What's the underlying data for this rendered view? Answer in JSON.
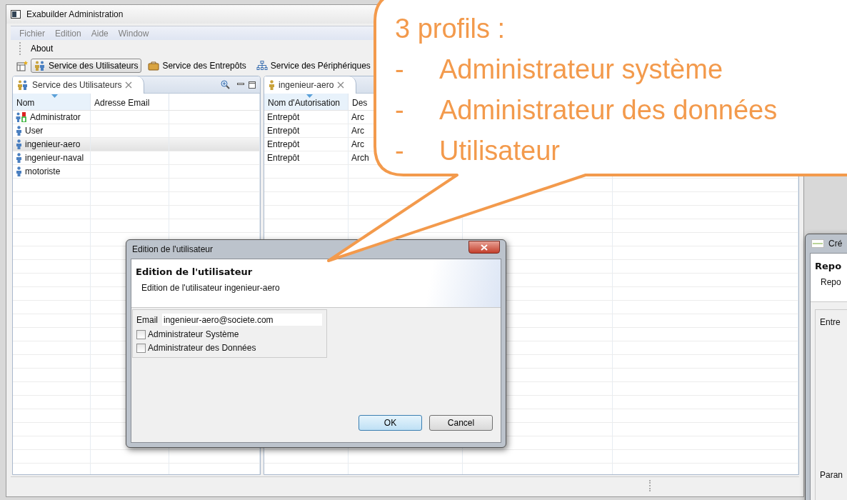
{
  "window": {
    "title": "Exabuilder Administration"
  },
  "menu": [
    "Fichier",
    "Edition",
    "Aide",
    "Window"
  ],
  "toolbar": [
    "About"
  ],
  "perspectives": [
    {
      "label": "Service des Utilisateurs",
      "selected": true,
      "kind": "users"
    },
    {
      "label": "Service des Entrepôts",
      "selected": false,
      "kind": "warehouse"
    },
    {
      "label": "Service des Périphériques",
      "selected": false,
      "kind": "devices"
    }
  ],
  "users_view": {
    "tab": "Service des Utilisateurs",
    "columns": [
      "Nom",
      "Adresse Email"
    ],
    "rows": [
      {
        "name": "Administrator",
        "kind": "admin",
        "selected": false
      },
      {
        "name": "User",
        "kind": "user",
        "selected": false
      },
      {
        "name": "ingenieur-aero",
        "kind": "user",
        "selected": true
      },
      {
        "name": "ingenieur-naval",
        "kind": "user",
        "selected": false
      },
      {
        "name": "motoriste",
        "kind": "user",
        "selected": false
      }
    ]
  },
  "detail_view": {
    "tab": "ingenieur-aero",
    "columns": [
      "Nom d'Autorisation",
      "Des"
    ],
    "rows": [
      [
        "Entrepôt",
        "Arc"
      ],
      [
        "Entrepôt",
        "Arc"
      ],
      [
        "Entrepôt",
        "Arc"
      ],
      [
        "Entrepôt",
        "Arch"
      ]
    ]
  },
  "dialog": {
    "title": "Edition de l'utilisateur",
    "heading": "Edition de l'utilisateur",
    "subtitle": "Edition de l'utilisateur ingenieur-aero",
    "email_label": "Email",
    "email": "ingenieur-aero@societe.com",
    "options": [
      {
        "label": "Administrateur Système",
        "checked": false
      },
      {
        "label": "Administrateur des Données",
        "checked": false
      }
    ],
    "buttons": [
      {
        "label": "OK",
        "default": true
      },
      {
        "label": "Cancel",
        "default": false
      }
    ]
  },
  "second_dialog": {
    "title": "Cré",
    "heading": "Repo",
    "subtitle": "Repo",
    "labels": [
      "Entre",
      "Paran"
    ]
  },
  "callout": {
    "title": "3 profils :",
    "items": [
      {
        "marker": "-",
        "text": "Administrateur système"
      },
      {
        "marker": "-",
        "text": "Administrateur des données"
      },
      {
        "marker": "-",
        "text": "Utilisateur"
      }
    ]
  }
}
